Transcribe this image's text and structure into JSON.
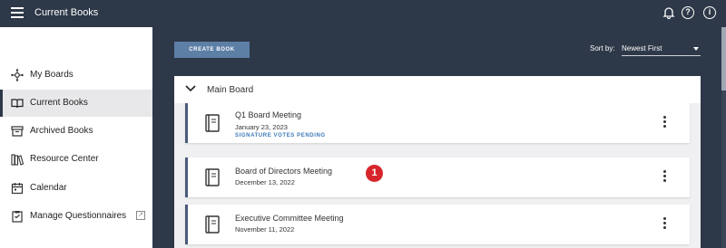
{
  "topbar": {
    "title": "Current Books",
    "icons": [
      "bell-icon",
      "help-icon",
      "info-icon"
    ]
  },
  "sidebar": {
    "items": [
      {
        "label": "My Boards",
        "icon": "network-icon",
        "active": false
      },
      {
        "label": "Current Books",
        "icon": "open-book-icon",
        "active": true
      },
      {
        "label": "Archived Books",
        "icon": "archive-box-icon",
        "active": false
      },
      {
        "label": "Resource Center",
        "icon": "books-icon",
        "active": false
      },
      {
        "label": "Calendar",
        "icon": "calendar-icon",
        "active": false
      },
      {
        "label": "Manage Questionnaires",
        "icon": "clipboard-icon",
        "active": false,
        "external": true
      }
    ]
  },
  "main": {
    "create_label": "CREATE BOOK",
    "sort_label": "Sort by:",
    "sort_value": "Newest First",
    "board": {
      "title": "Main Board",
      "books": [
        {
          "title": "Q1 Board Meeting",
          "date": "January 23, 2023",
          "status": "SIGNATURE VOTES PENDING"
        },
        {
          "title": "Board of Directors Meeting",
          "date": "December 13, 2022",
          "status": "",
          "badge": "1"
        },
        {
          "title": "Executive Committee Meeting",
          "date": "November 11, 2022",
          "status": ""
        }
      ]
    }
  },
  "colors": {
    "header": "#2d3848",
    "accent": "#5d7fa6",
    "status": "#3a78b8",
    "badge": "#d7262b"
  }
}
